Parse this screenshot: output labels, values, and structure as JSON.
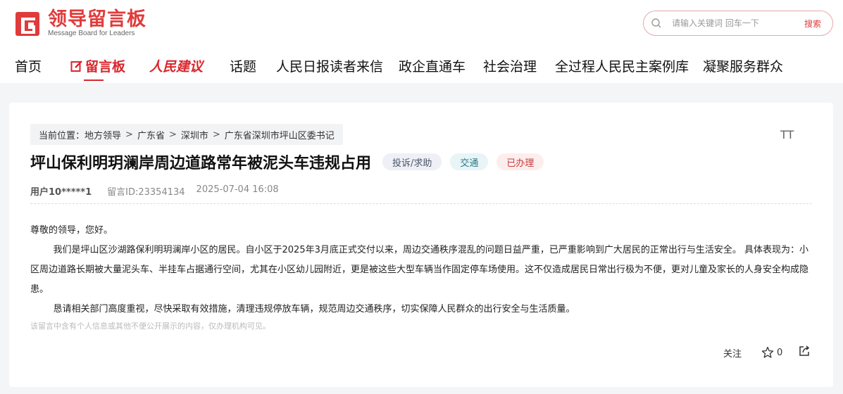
{
  "logo": {
    "cn": "领导留言板",
    "en": "Message Board for Leaders",
    "brand_color": "#e03b3b"
  },
  "search": {
    "placeholder": "请输入关键词 回车一下",
    "button": "搜索"
  },
  "nav": {
    "items": [
      "首页",
      "留言板",
      "人民建议",
      "话题",
      "人民日报读者来信",
      "政企直通车",
      "社会治理",
      "全过程人民民主案例库",
      "凝聚服务群众"
    ],
    "active": "留言板"
  },
  "breadcrumb": {
    "prefix": "当前位置：",
    "items": [
      "地方领导",
      "广东省",
      "深圳市",
      "广东省深圳市坪山区委书记"
    ]
  },
  "font_size_label": "TT",
  "message": {
    "title": "坪山保利明玥澜岸周边道路常年被泥头车违规占用",
    "tags": {
      "type": "投诉/求助",
      "field": "交通",
      "status": "已办理"
    },
    "user": "用户10*****1",
    "id": "留言ID:23354134",
    "date": "2025-07-04 16:08",
    "greeting": "尊敬的领导，您好。",
    "paragraph1": "我们是坪山区沙湖路保利明玥澜岸小区的居民。自小区于2025年3月底正式交付以来，周边交通秩序混乱的问题日益严重，已严重影响到广大居民的正常出行与生活安全。 具体表现为：小区周边道路长期被大量泥头车、半挂车占据通行空间，尤其在小区幼儿园附近，更是被这些大型车辆当作固定停车场使用。这不仅造成居民日常出行极为不便，更对儿童及家长的人身安全构成隐患。",
    "paragraph2": "恳请相关部门高度重视，尽快采取有效措施，清理违规停放车辆，规范周边交通秩序，切实保障人民群众的出行安全与生活质量。",
    "privacy_note": "该留言中含有个人信息或其他不便公开展示的内容，仅办理机构可见。"
  },
  "actions": {
    "follow": "关注",
    "like_count": "0"
  },
  "icons": [
    "logo-icon",
    "search-icon",
    "edit-icon",
    "font-size-icon",
    "star-icon",
    "share-icon"
  ]
}
